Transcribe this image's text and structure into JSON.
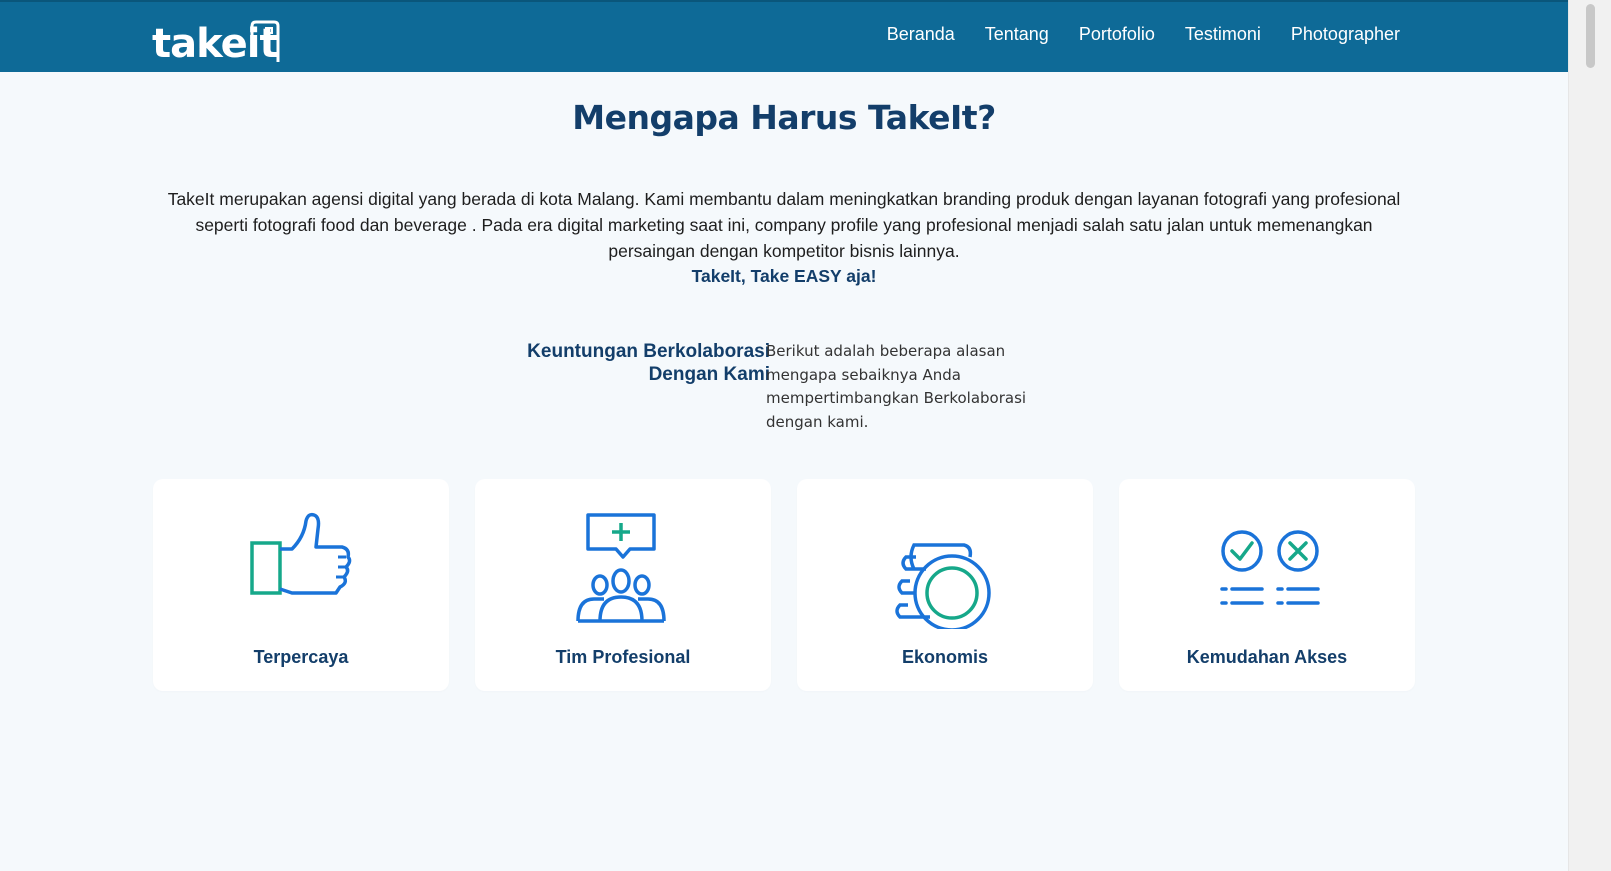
{
  "brand": {
    "logo_text": "takeit"
  },
  "nav": {
    "items": [
      {
        "label": "Beranda"
      },
      {
        "label": "Tentang"
      },
      {
        "label": "Portofolio"
      },
      {
        "label": "Testimoni"
      },
      {
        "label": "Photographer"
      }
    ]
  },
  "hero": {
    "title": "Mengapa Harus TakeIt?",
    "intro": "TakeIt merupakan agensi digital yang berada di kota Malang. Kami membantu dalam meningkatkan branding produk dengan layanan fotografi yang profesional seperti fotografi food dan beverage . Pada era digital marketing saat ini, company profile yang profesional menjadi salah satu jalan untuk memenangkan persaingan dengan kompetitor bisnis lainnya.",
    "tagline": "TakeIt, Take EASY aja!"
  },
  "benefits": {
    "heading_line1": "Keuntungan Berkolaborasi",
    "heading_line2": "Dengan Kami",
    "description": "Berikut adalah beberapa alasan mengapa sebaiknya Anda mempertimbangkan Berkolaborasi dengan kami."
  },
  "cards": [
    {
      "label": "Terpercaya",
      "icon": "thumbs-up-icon"
    },
    {
      "label": "Tim Profesional",
      "icon": "team-icon"
    },
    {
      "label": "Ekonomis",
      "icon": "coins-icon"
    },
    {
      "label": "Kemudahan Akses",
      "icon": "checklist-icon"
    }
  ],
  "colors": {
    "navbar": "#0e6a97",
    "heading": "#133e6a",
    "icon_blue": "#1a73d9",
    "icon_green": "#16a88a",
    "background": "#f5f9fc"
  }
}
